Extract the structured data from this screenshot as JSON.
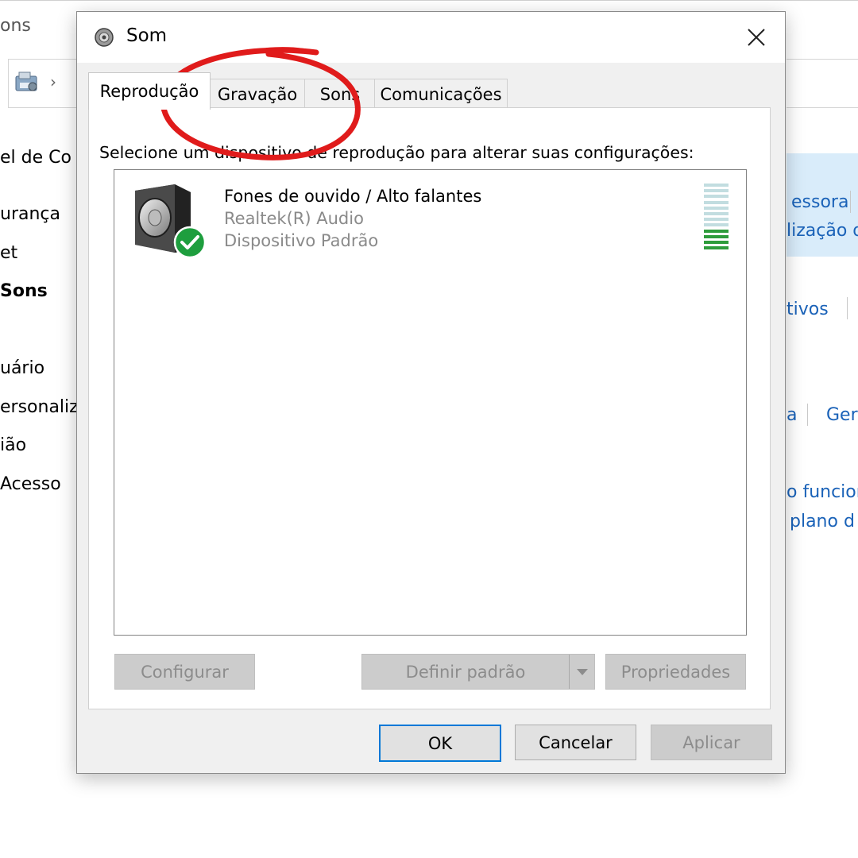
{
  "background": {
    "title_fragment": "ons",
    "sidebar": [
      "el de Co",
      "urança",
      "et",
      "Sons",
      "uário",
      "ersonaliz",
      "ião",
      "Acesso"
    ],
    "right_links": [
      "essora",
      "lização d",
      "tivos",
      "a",
      "Ger",
      "o funcion",
      "plano d"
    ]
  },
  "dialog": {
    "title": "Som",
    "tabs": [
      "Reprodução",
      "Gravação",
      "Sons",
      "Comunicações"
    ],
    "active_tab": "Reprodução",
    "instruction": "Selecione um dispositivo de reprodução para alterar suas configurações:",
    "devices": [
      {
        "name": "Fones de ouvido / Alto falantes",
        "driver": "Realtek(R) Audio",
        "status": "Dispositivo Padrão",
        "icon": "speaker-icon",
        "default_badge": "check-icon",
        "level_fraction": 0.35
      }
    ],
    "buttons": {
      "configure": "Configurar",
      "set_default": "Definir padrão",
      "properties": "Propriedades",
      "ok": "OK",
      "cancel": "Cancelar",
      "apply": "Aplicar"
    }
  },
  "colors": {
    "accent": "#0078d7",
    "link": "#1a62b8",
    "check_green": "#1e9e3e",
    "level_on": "#2e9c3c",
    "level_off": "#c2dde0",
    "annotation_red": "#e01b1b"
  }
}
